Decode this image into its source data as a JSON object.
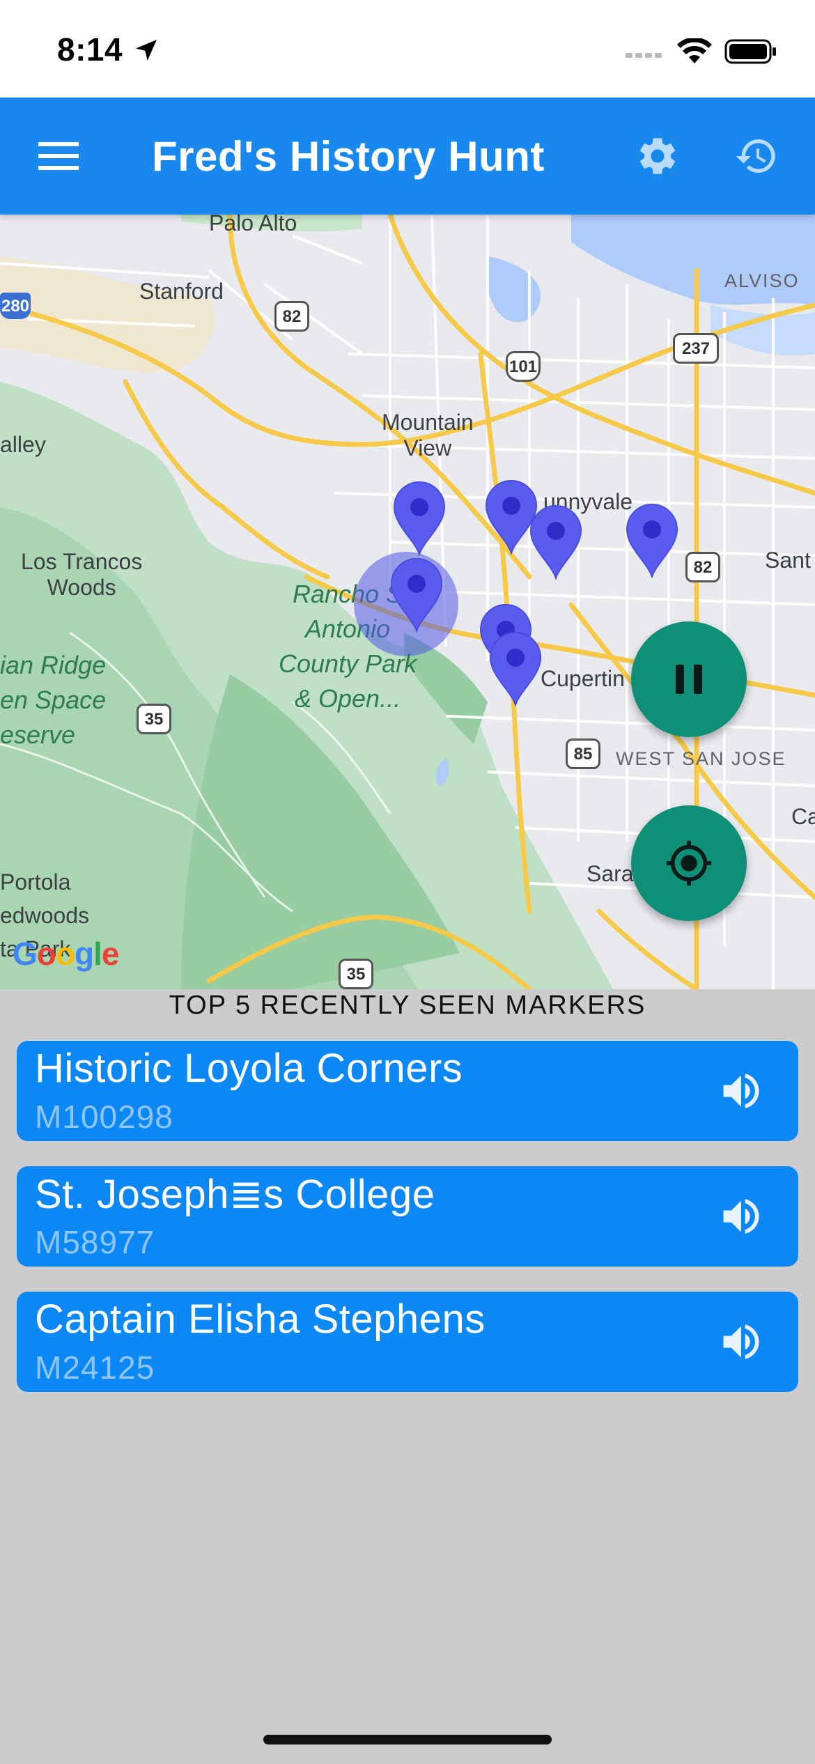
{
  "status_bar": {
    "time": "8:14"
  },
  "app_bar": {
    "title": "Fred's History Hunt",
    "menu_icon": "hamburger-menu-icon",
    "settings_icon": "gear-icon",
    "history_icon": "history-icon",
    "color": "#1888ef"
  },
  "map": {
    "labels": {
      "palo_alto": "Palo Alto",
      "stanford": "Stanford",
      "alviso": "ALVISO",
      "mountain_view": "Mountain\nView",
      "sunnyvale": "unnyvale",
      "valley": "alley",
      "los_trancos": "Los Trancos\nWoods",
      "rancho": "Rancho S\nAntonio\nCounty Park\n& Open...",
      "ridge": "ian Ridge\nen Space\neserve",
      "cupertino": "Cupertin",
      "west_san_jose": "WEST SAN JOSE",
      "santa_clara": "Sant",
      "campbell": "Ca",
      "saratoga": "Sara",
      "portola": "Portola\nedwoods\nta Park"
    },
    "shields": [
      "280",
      "82",
      "101",
      "237",
      "82",
      "35",
      "85",
      "35"
    ],
    "google_logo": "Google"
  },
  "fabs": {
    "pause_icon": "pause-icon",
    "locate_icon": "my-location-icon",
    "color": "#0f8e78"
  },
  "recent": {
    "heading": "TOP 5 RECENTLY SEEN MARKERS",
    "items": [
      {
        "title": "Historic Loyola Corners",
        "id": "M100298",
        "icon": "speaker-icon"
      },
      {
        "title": "St. Joseph≣s College",
        "id": "M58977",
        "icon": "speaker-icon"
      },
      {
        "title": "Captain Elisha Stephens",
        "id": "M24125",
        "icon": "speaker-icon"
      }
    ]
  }
}
